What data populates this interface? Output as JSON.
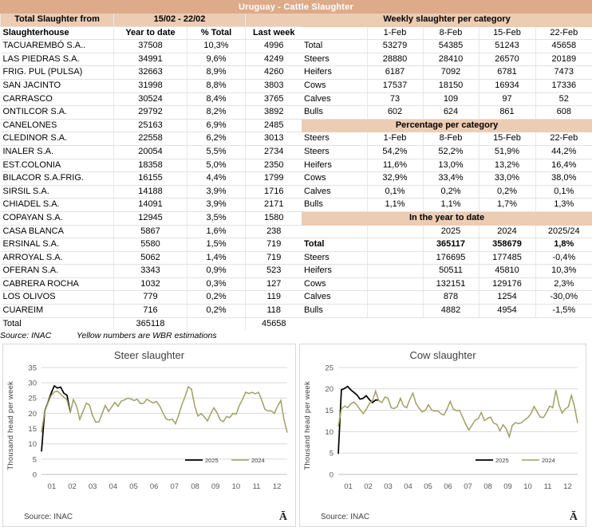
{
  "title": "Uruguay - Cattle Slaughter",
  "left_table": {
    "caption_label": "Total Slaughter from",
    "caption_period": "15/02 - 22/02",
    "columns": [
      "Slaughterhouse",
      "Year to date",
      "% Total",
      "Last week"
    ],
    "rows": [
      {
        "name": "TACUAREMBÓ S.A..",
        "ytd": "37508",
        "pct": "10,3%",
        "last": "4996"
      },
      {
        "name": "LAS PIEDRAS S.A.",
        "ytd": "34991",
        "pct": "9,6%",
        "last": "4249"
      },
      {
        "name": "FRIG. PUL (PULSA)",
        "ytd": "32663",
        "pct": "8,9%",
        "last": "4260"
      },
      {
        "name": "SAN JACINTO",
        "ytd": "31998",
        "pct": "8,8%",
        "last": "3803"
      },
      {
        "name": "CARRASCO",
        "ytd": "30524",
        "pct": "8,4%",
        "last": "3765"
      },
      {
        "name": "ONTILCOR S.A.",
        "ytd": "29792",
        "pct": "8,2%",
        "last": "3892"
      },
      {
        "name": "CANELONES",
        "ytd": "25163",
        "pct": "6,9%",
        "last": "2485"
      },
      {
        "name": "CLEDINOR S.A.",
        "ytd": "22558",
        "pct": "6,2%",
        "last": "3013"
      },
      {
        "name": "INALER S.A.",
        "ytd": "20054",
        "pct": "5,5%",
        "last": "2734"
      },
      {
        "name": "EST.COLONIA",
        "ytd": "18358",
        "pct": "5,0%",
        "last": "2350"
      },
      {
        "name": "BILACOR S.A.FRIG.",
        "ytd": "16155",
        "pct": "4,4%",
        "last": "1799"
      },
      {
        "name": "SIRSIL S.A.",
        "ytd": "14188",
        "pct": "3,9%",
        "last": "1716"
      },
      {
        "name": "CHIADEL S.A.",
        "ytd": "14091",
        "pct": "3,9%",
        "last": "2171"
      },
      {
        "name": "COPAYAN S.A.",
        "ytd": "12945",
        "pct": "3,5%",
        "last": "1580"
      },
      {
        "name": "CASA BLANCA",
        "ytd": "5867",
        "pct": "1,6%",
        "last": "238"
      },
      {
        "name": "ERSINAL S.A.",
        "ytd": "5580",
        "pct": "1,5%",
        "last": "719"
      },
      {
        "name": "ARROYAL S.A.",
        "ytd": "5062",
        "pct": "1,4%",
        "last": "719"
      },
      {
        "name": "OFERAN S.A.",
        "ytd": "3343",
        "pct": "0,9%",
        "last": "523"
      },
      {
        "name": "CABRERA ROCHA",
        "ytd": "1032",
        "pct": "0,3%",
        "last": "127"
      },
      {
        "name": "LOS OLIVOS",
        "ytd": "779",
        "pct": "0,2%",
        "last": "119"
      },
      {
        "name": "CUAREIM",
        "ytd": "716",
        "pct": "0,2%",
        "last": "118"
      }
    ],
    "total": {
      "name": "Total",
      "ytd": "365118",
      "pct": "",
      "last": "45658"
    },
    "source": "Source: INAC",
    "note": "Yellow numbers are WBR estimations"
  },
  "weekly": {
    "section_title": "Weekly slaughter per category",
    "dates": [
      "1-Feb",
      "8-Feb",
      "15-Feb",
      "22-Feb"
    ],
    "rows": [
      {
        "label": "Total",
        "v": [
          "53279",
          "54385",
          "51243",
          "45658"
        ]
      },
      {
        "label": "Steers",
        "v": [
          "28880",
          "28410",
          "26570",
          "20189"
        ]
      },
      {
        "label": "Heifers",
        "v": [
          "6187",
          "7092",
          "6781",
          "7473"
        ]
      },
      {
        "label": "Cows",
        "v": [
          "17537",
          "18150",
          "16934",
          "17336"
        ]
      },
      {
        "label": "Calves",
        "v": [
          "73",
          "109",
          "97",
          "52"
        ]
      },
      {
        "label": "Bulls",
        "v": [
          "602",
          "624",
          "861",
          "608"
        ]
      }
    ]
  },
  "percentage": {
    "section_title": "Percentage per category",
    "header_label": "Steers",
    "dates": [
      "1-Feb",
      "8-Feb",
      "15-Feb",
      "22-Feb"
    ],
    "rows": [
      {
        "label": "Steers",
        "v": [
          "54,2%",
          "52,2%",
          "51,9%",
          "44,2%"
        ]
      },
      {
        "label": "Heifers",
        "v": [
          "11,6%",
          "13,0%",
          "13,2%",
          "16,4%"
        ]
      },
      {
        "label": "Cows",
        "v": [
          "32,9%",
          "33,4%",
          "33,0%",
          "38,0%"
        ]
      },
      {
        "label": "Calves",
        "v": [
          "0,1%",
          "0,2%",
          "0,2%",
          "0,1%"
        ]
      },
      {
        "label": "Bulls",
        "v": [
          "1,1%",
          "1,1%",
          "1,7%",
          "1,3%"
        ]
      }
    ]
  },
  "ytd": {
    "section_title": "In the year to date",
    "headers": [
      "2025",
      "2024",
      "2025/24"
    ],
    "rows": [
      {
        "label": "Total",
        "v": [
          "365117",
          "358679",
          "1,8%"
        ],
        "bold": true
      },
      {
        "label": "Steers",
        "v": [
          "176695",
          "177485",
          "-0,4%"
        ],
        "bold": false
      },
      {
        "label": "Heifers",
        "v": [
          "50511",
          "45810",
          "10,3%"
        ],
        "bold": false
      },
      {
        "label": "Cows",
        "v": [
          "132151",
          "129176",
          "2,3%"
        ],
        "bold": false
      },
      {
        "label": "Calves",
        "v": [
          "878",
          "1254",
          "-30,0%"
        ],
        "bold": false
      },
      {
        "label": "Bulls",
        "v": [
          "4882",
          "4954",
          "-1,5%"
        ],
        "bold": false
      }
    ]
  },
  "colors": {
    "title_bar": "#ddab8a",
    "band": "#edccb4",
    "line_2025": "#000000",
    "line_2024": "#a0a066"
  },
  "chart_data": [
    {
      "type": "line",
      "title": "Steer slaughter",
      "xlabel": "",
      "ylabel": "Thousand head per week",
      "ylim": [
        0,
        35
      ],
      "yticks": [
        0,
        5,
        10,
        15,
        20,
        25,
        30,
        35
      ],
      "xticks": [
        "01",
        "02",
        "03",
        "04",
        "05",
        "06",
        "07",
        "08",
        "09",
        "10",
        "11",
        "12"
      ],
      "grid": true,
      "legend_position": "bottom-right",
      "source": "Source: INAC",
      "logo": "Ā",
      "series": [
        {
          "name": "2025",
          "color": "#000000",
          "values": [
            7.5,
            20.7,
            23.5,
            26.5,
            29.0,
            28.3,
            28.6,
            26.6,
            25.9,
            20.3
          ]
        },
        {
          "name": "2024",
          "color": "#a0a066",
          "values": [
            13.7,
            20.5,
            23.3,
            25.8,
            27.0,
            27.3,
            26.3,
            25.3,
            24.4,
            20.2,
            24.5,
            22.4,
            18.0,
            20.6,
            23.3,
            22.8,
            19.3,
            17.1,
            17.2,
            19.9,
            22.6,
            20.6,
            22.1,
            23.6,
            22.3,
            24.0,
            24.4,
            25.0,
            24.7,
            24.2,
            24.6,
            23.2,
            23.3,
            24.6,
            24.0,
            23.4,
            23.9,
            22.5,
            20.3,
            18.2,
            17.8,
            18.1,
            16.6,
            19.5,
            22.9,
            25.5,
            28.7,
            27.9,
            22.5,
            19.1,
            19.9,
            18.9,
            17.5,
            19.8,
            21.8,
            20.2,
            17.8,
            17.3,
            19.0,
            18.6,
            20.0,
            19.7,
            22.6,
            24.6,
            26.9,
            26.5,
            26.9,
            26.4,
            26.9,
            24.4,
            21.3,
            20.8,
            20.8,
            20.0,
            22.4,
            24.2,
            17.9,
            13.7
          ]
        }
      ]
    },
    {
      "type": "line",
      "title": "Cow slaughter",
      "xlabel": "",
      "ylabel": "Thousand head per week",
      "ylim": [
        0,
        25
      ],
      "yticks": [
        0,
        5,
        10,
        15,
        20,
        25
      ],
      "xticks": [
        "01",
        "02",
        "03",
        "04",
        "05",
        "06",
        "07",
        "08",
        "09",
        "10",
        "11",
        "12"
      ],
      "grid": true,
      "legend_position": "bottom-right",
      "source": "Source: INAC",
      "logo": "Ā",
      "series": [
        {
          "name": "2025",
          "color": "#000000",
          "values": [
            4.8,
            19.8,
            20.1,
            20.6,
            19.8,
            19.2,
            18.6,
            17.6,
            17.8,
            18.4,
            17.5,
            16.8,
            17.4,
            17.4
          ]
        },
        {
          "name": "2024",
          "color": "#a0a066",
          "values": [
            11.2,
            15.3,
            16.0,
            15.6,
            16.5,
            16.9,
            16.2,
            15.2,
            14.2,
            15.2,
            16.6,
            17.2,
            19.5,
            17.3,
            16.8,
            18.1,
            17.8,
            15.6,
            15.4,
            15.9,
            17.8,
            16.0,
            15.6,
            17.5,
            19.0,
            16.6,
            15.5,
            14.6,
            15.0,
            16.3,
            15.1,
            14.8,
            14.9,
            14.2,
            13.9,
            15.3,
            17.1,
            15.3,
            14.9,
            15.0,
            13.4,
            11.7,
            10.4,
            11.5,
            12.7,
            13.0,
            14.5,
            12.6,
            13.1,
            13.4,
            12.0,
            11.7,
            10.2,
            11.6,
            10.7,
            8.8,
            11.5,
            12.1,
            11.9,
            12.1,
            12.8,
            13.3,
            14.2,
            15.9,
            14.6,
            13.4,
            13.3,
            14.5,
            16.0,
            15.6,
            19.7,
            16.3,
            14.3,
            15.3,
            15.8,
            18.5,
            15.8,
            12.0
          ]
        }
      ]
    }
  ]
}
